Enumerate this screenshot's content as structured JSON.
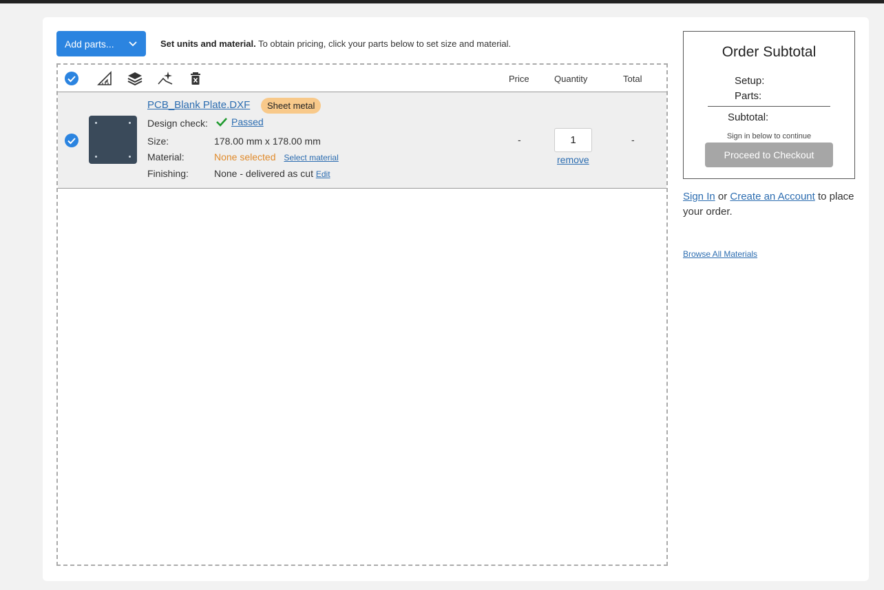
{
  "toolbar": {
    "add_parts_label": "Add parts...",
    "instructions_bold": "Set units and material.",
    "instructions_rest": " To obtain pricing, click your parts below to set size and material."
  },
  "table": {
    "columns": {
      "price": "Price",
      "quantity": "Quantity",
      "total": "Total"
    },
    "icons": [
      "check-circle-icon",
      "ruler-triangle-icon",
      "layers-icon",
      "sparkle-icon",
      "trash-icon"
    ]
  },
  "part": {
    "filename": "PCB_Blank Plate.DXF",
    "badge": "Sheet metal",
    "design_check_label": "Design check:",
    "design_check_value": "Passed",
    "size_label": "Size:",
    "size_value": "178.00 mm x 178.00 mm",
    "material_label": "Material:",
    "material_value": "None selected",
    "material_link": "Select material",
    "finishing_label": "Finishing:",
    "finishing_value": "None - delivered as cut",
    "finishing_link": "Edit",
    "price": "-",
    "quantity": "1",
    "remove_label": "remove",
    "total": "-"
  },
  "order": {
    "title": "Order Subtotal",
    "setup_label": "Setup:",
    "parts_label": "Parts:",
    "subtotal_label": "Subtotal:",
    "note": "Sign in below to continue",
    "checkout_label": "Proceed to Checkout"
  },
  "account": {
    "sign_in": "Sign In",
    "or": " or ",
    "create": "Create an Account",
    "rest": " to place your order."
  },
  "browse_label": "Browse All Materials",
  "colors": {
    "primary": "#2b84e0",
    "link": "#2b6cb0",
    "badge": "#f8c98a",
    "warning": "#e08a2a",
    "success": "#1f9a2e",
    "disabled": "#a6a6a6"
  }
}
